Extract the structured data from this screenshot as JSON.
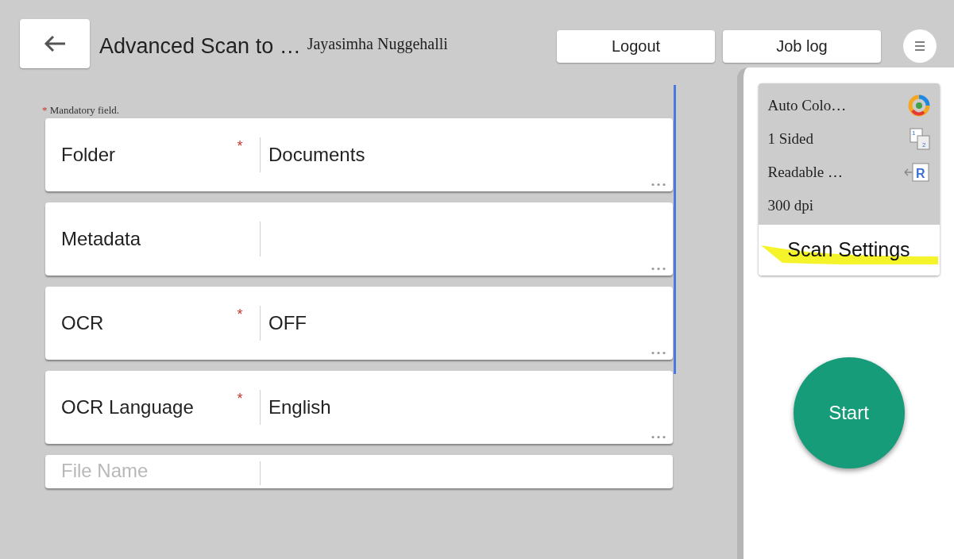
{
  "header": {
    "title": "Advanced Scan to …",
    "user_name": "Jayasimha Nuggehalli",
    "buttons": [
      "Logout",
      "Job log"
    ]
  },
  "form": {
    "mandatory_note": "Mandatory field.",
    "required_mark": "*",
    "fields": [
      {
        "label": "Folder",
        "required": true,
        "value": "Documents"
      },
      {
        "label": "Metadata",
        "required": false
      },
      {
        "label": "OCR",
        "required": true,
        "value": "OFF"
      },
      {
        "label": "OCR Language",
        "required": true,
        "value": "English"
      },
      {
        "label": "File Name",
        "required": false,
        "faded": true
      }
    ]
  },
  "summary": {
    "settings": [
      {
        "text": "Auto Colo…",
        "kind": "color"
      },
      {
        "text": "1 Sided",
        "kind": "sides",
        "icon_text": [
          "1",
          "2"
        ]
      },
      {
        "text": "Readable …",
        "kind": "orientation",
        "icon_text": [
          "R"
        ]
      },
      {
        "text": "300 dpi",
        "kind": "none"
      }
    ],
    "button": "Scan Settings",
    "highlighted": true
  },
  "start_button": "Start"
}
